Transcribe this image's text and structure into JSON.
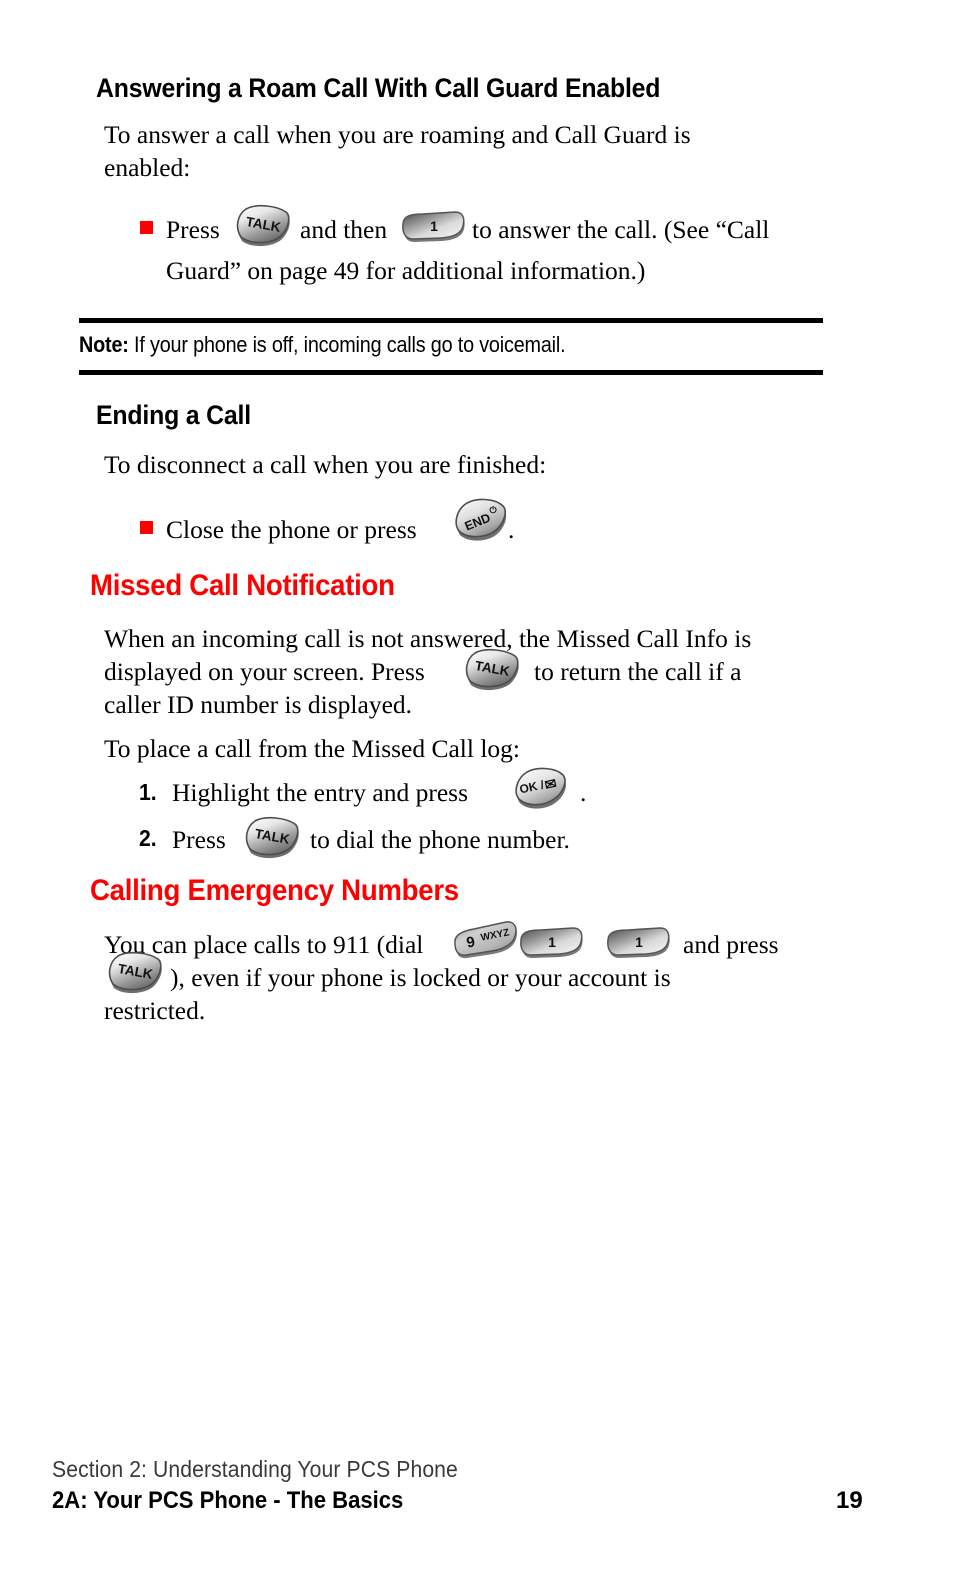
{
  "document": {
    "title": "PCS Phone User Guide page 19",
    "accent_red": "#ff0000",
    "page_background": "#ffffff"
  },
  "sections": [
    {
      "id": "answering-roam-call",
      "heading": "Answering a Roam Call With Call Guard Enabled",
      "heading_level": "sub",
      "intro_line1": "To answer a call when you are roaming and Call Guard is",
      "intro_line2": "enabled:",
      "bullet_line1_a": "Press",
      "bullet_line1_b": "and then",
      "bullet_line1_c": "to answer the call. (See “Call",
      "bullet_line2": "Guard” on page 49 for additional information.)"
    },
    {
      "id": "ending-a-call",
      "heading": "Ending a Call",
      "heading_level": "sub",
      "intro": "To disconnect a call when you are finished:",
      "bullet_a": "Close the phone or press",
      "bullet_b": "."
    },
    {
      "id": "missed-call-notification",
      "heading": "Missed Call Notification",
      "heading_level": "main",
      "para_line1": "When an incoming call is not answered, the Missed Call Info is",
      "para_line2_a": "displayed on your screen. Press",
      "para_line2_b": "to return the call if a",
      "para_line3": "caller ID number is displayed.",
      "intro2": "To place a call from the Missed Call log:",
      "steps": [
        {
          "number": "1.",
          "text_a": "Highlight the entry and press",
          "text_b": "."
        },
        {
          "number": "2.",
          "text_a": "Press",
          "text_b": "to dial the phone number."
        }
      ]
    },
    {
      "id": "calling-emergency-numbers",
      "heading": "Calling Emergency Numbers",
      "heading_level": "main",
      "para_line1_a": "You can place calls to 911 (dial",
      "para_line1_b": "and press",
      "para_line2_b": "), even if your phone is locked or your account is",
      "para_line3": "restricted."
    }
  ],
  "note": {
    "label": "Note:",
    "text": "If your phone is off, incoming calls go to voicemail."
  },
  "keys": {
    "talk": {
      "label": "TALK",
      "name": "talk-key"
    },
    "one": {
      "label": "1",
      "name": "one-key"
    },
    "end": {
      "label": "END",
      "symbol": "⏻",
      "name": "end-key"
    },
    "ok": {
      "label": "OK /",
      "symbol": "✉",
      "name": "ok-message-key"
    },
    "nine": {
      "label": "9",
      "letters": "WXYZ",
      "name": "nine-wxyz-key"
    }
  },
  "footer": {
    "section_line": "Section 2: Understanding Your PCS Phone",
    "chapter_line": "2A: Your PCS Phone - The Basics",
    "page_number": "19"
  }
}
